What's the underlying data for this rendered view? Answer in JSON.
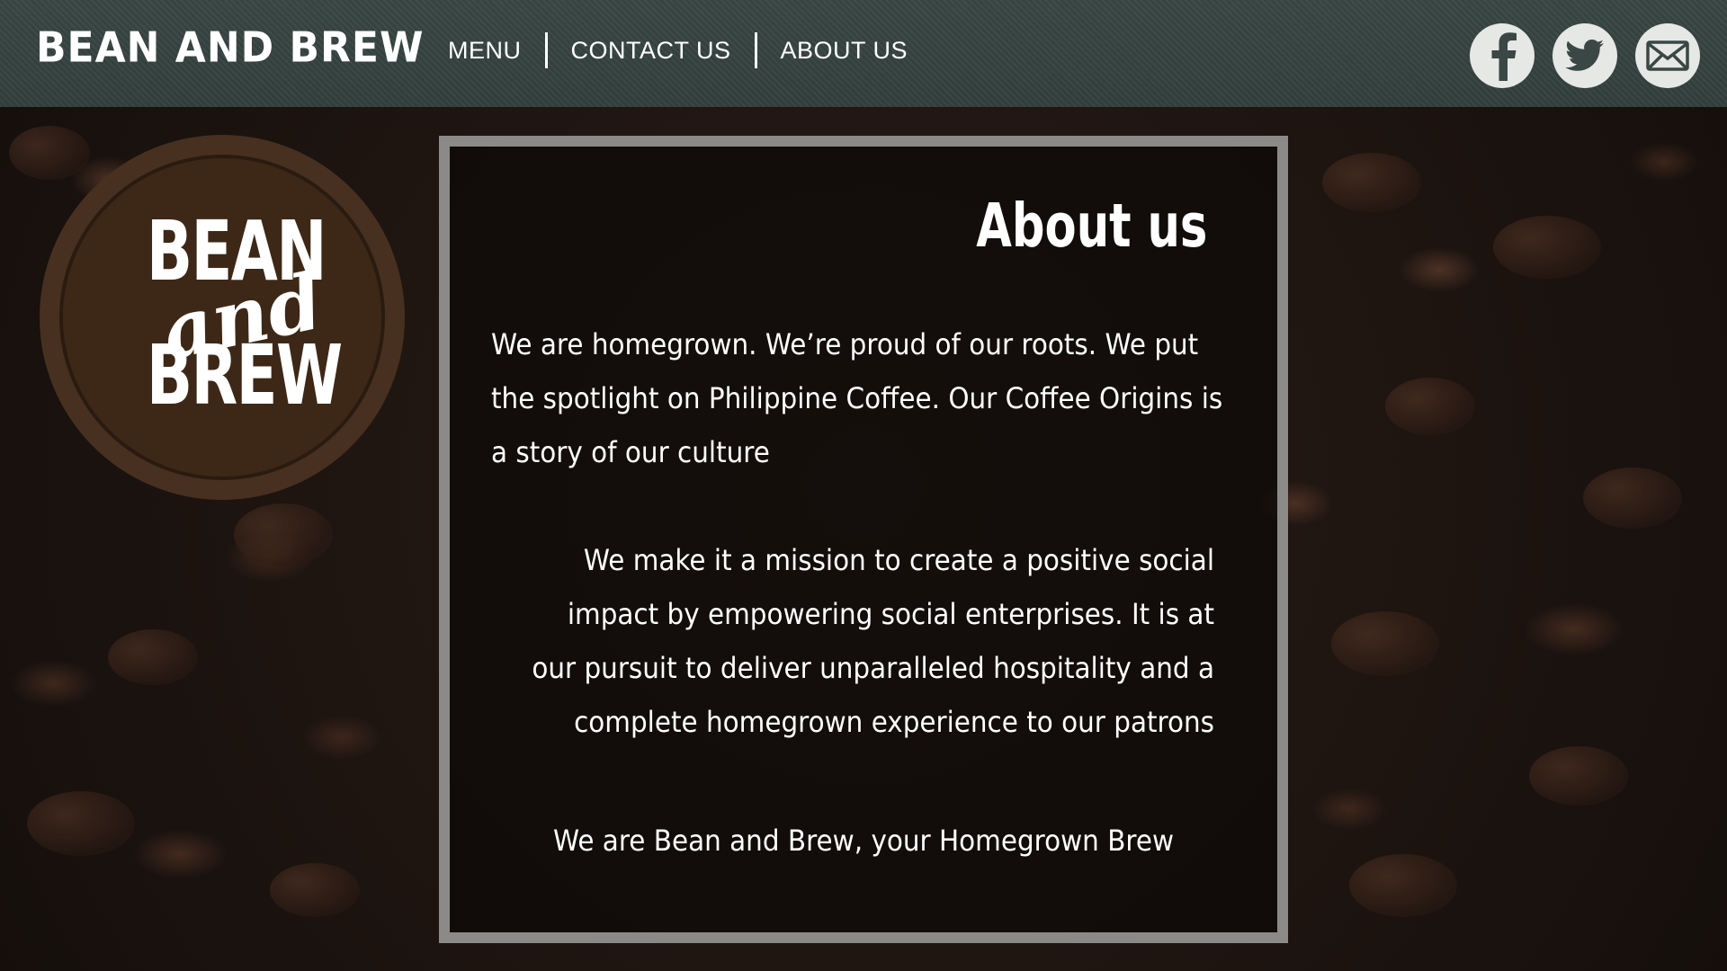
{
  "header": {
    "brand": "BEAN AND BREW",
    "nav": [
      {
        "label": "MENU"
      },
      {
        "label": "CONTACT US"
      },
      {
        "label": "ABOUT US"
      }
    ],
    "social": [
      {
        "icon": "facebook-icon"
      },
      {
        "icon": "twitter-icon"
      },
      {
        "icon": "mail-icon"
      }
    ]
  },
  "logo": {
    "line1": "BEAN",
    "line2": "and",
    "line3": "BREW"
  },
  "about": {
    "title": "About us",
    "paragraph1": "We are homegrown. We’re proud of our roots. We  put the spotlight on Philippine Coffee. Our Coffee Origins is a story of our culture",
    "paragraph2": "We make it a mission to create a positive social impact by empowering social enterprises. It is at our pursuit to deliver unparalleled hospitality and a complete homegrown experience to our patrons",
    "paragraph3": "We are Bean and Brew, your Homegrown Brew"
  },
  "colors": {
    "navbar": "#3a4744",
    "logo_brown": "#47301f",
    "panel_border": "#8c8a88",
    "text": "#ffffff",
    "social_bg": "#e6e8e6"
  }
}
